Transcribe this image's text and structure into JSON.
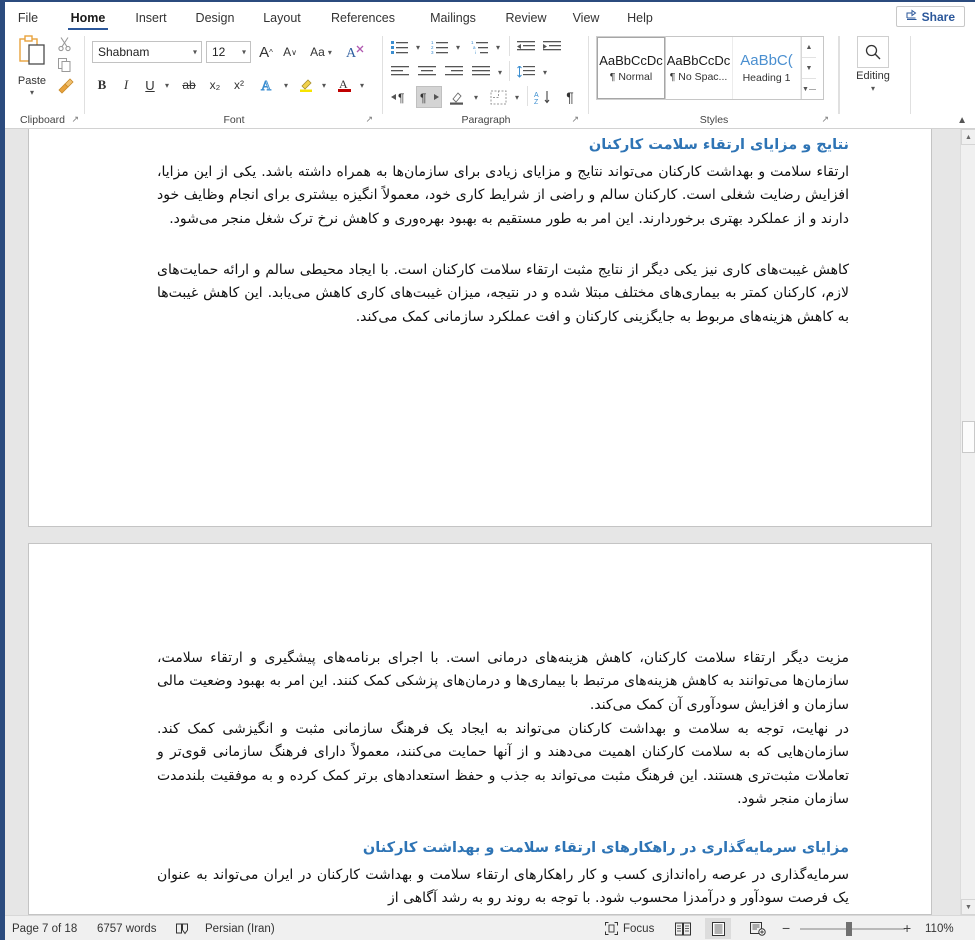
{
  "app": {
    "accent_blue": "#2b579a",
    "heading_blue": "#2e74b5",
    "frame_blue": "#2b4b7e"
  },
  "tabs": [
    {
      "label": "File",
      "active": false
    },
    {
      "label": "Home",
      "active": true
    },
    {
      "label": "Insert",
      "active": false
    },
    {
      "label": "Design",
      "active": false
    },
    {
      "label": "Layout",
      "active": false
    },
    {
      "label": "References",
      "active": false
    },
    {
      "label": "Mailings",
      "active": false
    },
    {
      "label": "Review",
      "active": false
    },
    {
      "label": "View",
      "active": false
    },
    {
      "label": "Help",
      "active": false
    }
  ],
  "share": {
    "label": "Share",
    "icon": "share-icon"
  },
  "ribbon": {
    "clipboard": {
      "label": "Clipboard",
      "paste_label": "Paste",
      "cut_icon": "scissors-icon",
      "copy_icon": "copy-icon",
      "format_painter_icon": "format-painter-icon",
      "dialog_launcher": "dialog-launcher-icon"
    },
    "font": {
      "label": "Font",
      "font_name": "Shabnam",
      "font_size": "12",
      "grow_font": "A",
      "shrink_font": "A",
      "change_case": "Aa",
      "clear_formatting": "clear-formatting-icon",
      "bold": "B",
      "italic": "I",
      "underline": "U",
      "strikethrough": "ab",
      "subscript": "x₂",
      "superscript": "x²",
      "text_effects": "A",
      "highlight": "highlight-icon",
      "font_color": "A",
      "dialog_launcher": "dialog-launcher-icon"
    },
    "paragraph": {
      "label": "Paragraph",
      "bullets": "bullets-icon",
      "numbering": "numbering-icon",
      "multilevel": "multilevel-list-icon",
      "decrease_indent": "decrease-indent-icon",
      "increase_indent": "increase-indent-icon",
      "align_left": "align-left-icon",
      "align_center": "align-center-icon",
      "align_right": "align-right-icon",
      "justify": "justify-icon",
      "line_spacing": "line-spacing-icon",
      "ltr_text": "ltr-direction-icon",
      "rtl_text": "rtl-direction-icon",
      "shading": "shading-icon",
      "borders": "borders-icon",
      "sort": "sort-icon",
      "show_marks": "¶",
      "dialog_launcher": "dialog-launcher-icon"
    },
    "styles": {
      "label": "Styles",
      "items": [
        {
          "preview": "AaBbCcDc",
          "name": "¶ Normal",
          "active": true,
          "heading": false
        },
        {
          "preview": "AaBbCcDc",
          "name": "¶ No Spac...",
          "active": false,
          "heading": false
        },
        {
          "preview": "AaBbC(",
          "name": "Heading 1",
          "active": false,
          "heading": true
        }
      ],
      "dialog_launcher": "dialog-launcher-icon"
    },
    "editing": {
      "label": "Editing",
      "icon": "search-icon",
      "caret": "chevron-down-icon"
    },
    "collapse_icon": "chevron-up-icon"
  },
  "document": {
    "page1": {
      "heading": "نتایج و مزایای ارتقاء سلامت کارکنان",
      "paragraph1": "ارتقاء سلامت و بهداشت کارکنان می‌تواند نتایج و مزایای زیادی برای سازمان‌ها به همراه داشته باشد. یکی از این مزایا، افزایش رضایت شغلی است. کارکنان سالم و راضی از شرایط کاری خود، معمولاً انگیزه بیشتری برای انجام وظایف خود دارند و از عملکرد بهتری برخوردارند. این امر به طور مستقیم به بهبود بهره‌وری و کاهش نرخ ترک شغل منجر می‌شود.",
      "paragraph2": "کاهش غیبت‌های کاری نیز یکی دیگر از نتایج مثبت ارتقاء سلامت کارکنان است. با ایجاد محیطی سالم و ارائه حمایت‌های لازم، کارکنان کمتر به بیماری‌های مختلف مبتلا شده و در نتیجه، میزان غیبت‌های کاری کاهش می‌یابد. این کاهش غیبت‌ها به کاهش هزینه‌های مربوط به جایگزینی کارکنان و افت عملکرد سازمانی کمک می‌کند."
    },
    "page2": {
      "paragraph1": "مزیت دیگر ارتقاء سلامت کارکنان، کاهش هزینه‌های درمانی است. با اجرای برنامه‌های پیشگیری و ارتقاء سلامت، سازمان‌ها می‌توانند به کاهش هزینه‌های مرتبط با بیماری‌ها و درمان‌های پزشکی کمک کنند. این امر به بهبود وضعیت مالی سازمان و افزایش سودآوری آن کمک می‌کند.",
      "paragraph2": "در نهایت، توجه به سلامت و بهداشت کارکنان می‌تواند به ایجاد یک فرهنگ سازمانی مثبت و انگیزشی کمک کند. سازمان‌هایی که به سلامت کارکنان اهمیت می‌دهند و از آنها حمایت می‌کنند، معمولاً دارای فرهنگ سازمانی قوی‌تر و تعاملات مثبت‌تری هستند. این فرهنگ مثبت می‌تواند به جذب و حفظ استعدادهای برتر کمک کرده و به موفقیت بلندمدت سازمان منجر شود.",
      "heading": "مزایای سرمایه‌گذاری در راهکارهای ارتقاء سلامت و بهداشت کارکنان",
      "paragraph3": "سرمایه‌گذاری در عرصه راه‌اندازی کسب و کار راهکارهای ارتقاء سلامت و بهداشت کارکنان در ایران می‌تواند به عنوان یک فرصت سودآور و درآمدزا محسوب شود. با توجه به روند رو به رشد آگاهی از"
    }
  },
  "statusbar": {
    "page": "Page 7 of 18",
    "words": "6757 words",
    "proofing_icon": "proofing-errors-icon",
    "language": "Persian (Iran)",
    "focus_label": "Focus",
    "focus_icon": "focus-icon",
    "view_read": "read-mode-icon",
    "view_print": "print-layout-icon",
    "view_web": "web-layout-icon",
    "zoom_out": "−",
    "zoom_in": "+",
    "zoom_level": "110%"
  }
}
